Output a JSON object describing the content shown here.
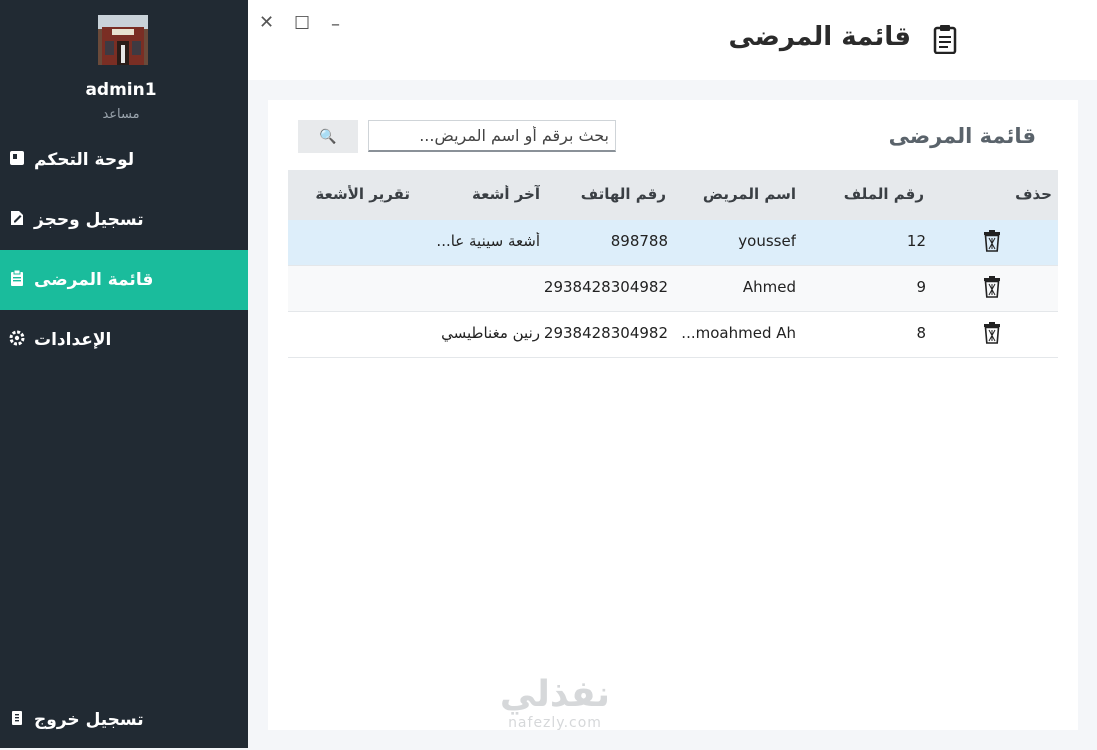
{
  "sidebar": {
    "username": "admin1",
    "role": "مساعد",
    "items": [
      {
        "label": "لوحة التحكم",
        "icon": "dashboard-icon"
      },
      {
        "label": "تسجيل وحجز",
        "icon": "edit-icon"
      },
      {
        "label": "قائمة المرضى",
        "icon": "clipboard-icon",
        "active": true
      },
      {
        "label": "الإعدادات",
        "icon": "gear-icon"
      }
    ],
    "logout": {
      "label": "تسجيل خروج",
      "icon": "logout-icon"
    }
  },
  "window": {
    "close": "✕",
    "maximize": "☐",
    "minimize": "–"
  },
  "header": {
    "title": "قائمة المرضى"
  },
  "card": {
    "title": "قائمة المرضى",
    "search": {
      "placeholder": "بحث برقم أو اسم المريض...",
      "button_icon": "🔍"
    }
  },
  "table": {
    "columns": [
      "حذف",
      "رقم الملف",
      "اسم المريض",
      "رقم الهاتف",
      "آخر أشعة",
      "تقرير الأشعة"
    ],
    "rows": [
      {
        "file": "12",
        "name": "youssef",
        "phone": "898788",
        "last_xray": "أشعة سينية عا...",
        "report": ""
      },
      {
        "file": "9",
        "name": "Ahmed",
        "phone": "2938428304982",
        "last_xray": "",
        "report": ""
      },
      {
        "file": "8",
        "name": "moahmed Ah...",
        "phone": "2938428304982",
        "last_xray": "رنين مغناطيسي",
        "report": ""
      }
    ]
  },
  "watermark": {
    "ar": "نفذلي",
    "en": "nafezly.com"
  },
  "colors": {
    "sidebar_bg": "#212a33",
    "active": "#1abc9c",
    "selected_row": "#ddeefa"
  }
}
